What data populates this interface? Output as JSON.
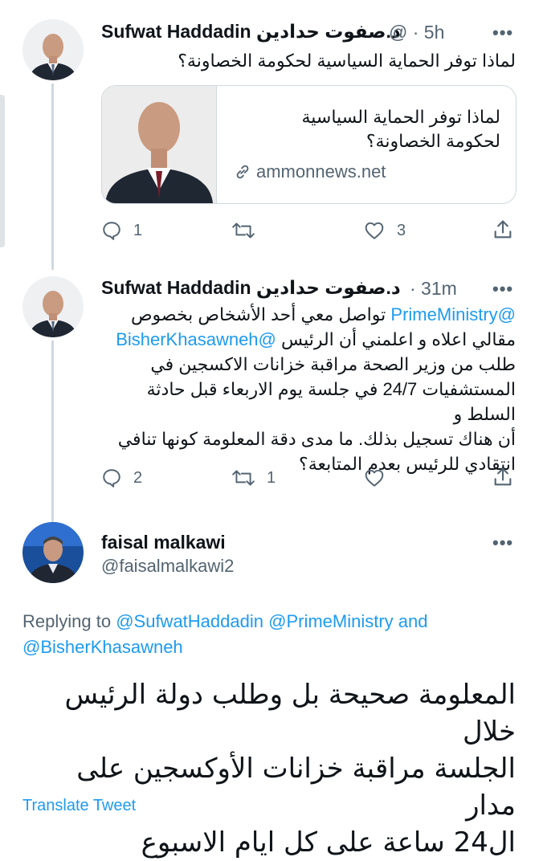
{
  "tweets": [
    {
      "name": "Sufwat Haddadin د.صفوت حدادين",
      "handle_meta": "@ · 5h",
      "more": "•••",
      "text": "لماذا توفر الحماية السياسية لحكومة الخصاونة؟",
      "card": {
        "title_line1": "لماذا توفر الحماية السياسية",
        "title_line2": "لحكومة الخصاونة؟",
        "domain": "ammonnews.net"
      },
      "actions": {
        "replies": "1",
        "retweets": "",
        "likes": "3"
      }
    },
    {
      "name": "Sufwat Haddadin د.صفوت حدادين",
      "handle_meta": "· 31m",
      "more": "•••",
      "mention1": "@PrimeMinistry",
      "line1_rest": "تواصل معي أحد الأشخاص بخصوص",
      "line2_text": "مقالي اعلاه و اعلمني أن الرئيس",
      "mention2": "@BisherKhasawneh",
      "lines": [
        "طلب من وزير الصحة مراقبة خزانات الاكسجين في",
        "المستشفيات 24/7 في جلسة يوم الاربعاء قبل حادثة السلط و",
        "أن هناك تسجيل بذلك. ما مدى دقة المعلومة كونها تنافي",
        "انتقادي للرئيس بعدم المتابعة؟"
      ],
      "actions": {
        "replies": "2",
        "retweets": "1",
        "likes": ""
      }
    }
  ],
  "reply": {
    "name": "faisal malkawi",
    "handle": "@faisalmalkawi2",
    "more": "•••",
    "replying_to_label": "Replying to",
    "replying_to_1": "@SufwatHaddadin",
    "replying_to_2": "@PrimeMinistry",
    "and": "and",
    "replying_to_3": "@BisherKhasawneh",
    "lines": [
      "المعلومة صحيحة بل وطلب دولة الرئيس خلال",
      "الجلسة مراقبة خزانات الأوكسجين على مدار",
      "ال24 ساعة على كل ايام الاسبوع"
    ],
    "translate": "Translate Tweet"
  },
  "colors": {
    "accent": "#1d9bf0",
    "secondary": "#536471",
    "thread": "#cfd9de"
  },
  "icons": [
    "reply-icon",
    "retweet-icon",
    "like-icon",
    "share-icon",
    "link-icon"
  ]
}
